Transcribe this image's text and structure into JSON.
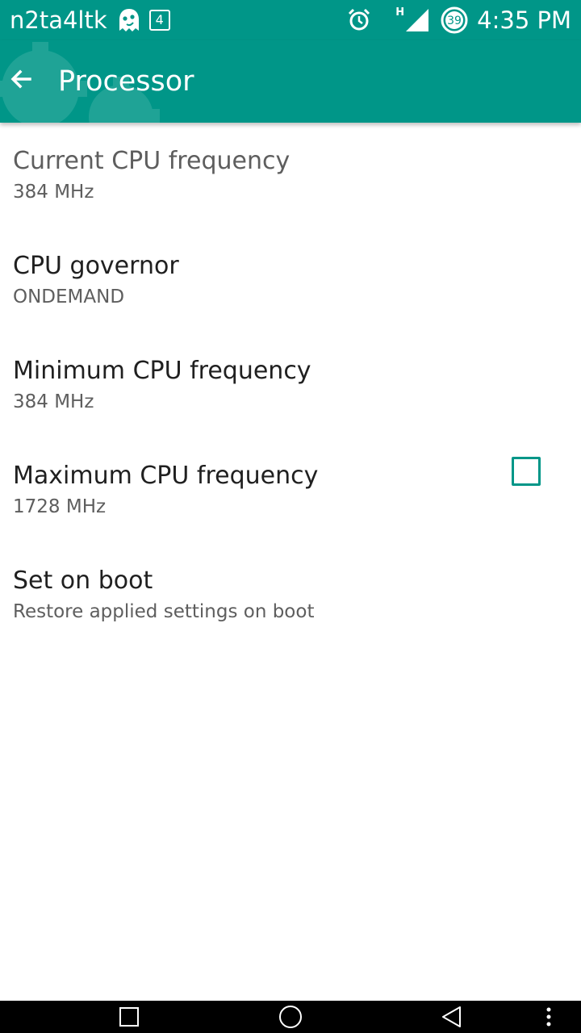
{
  "status_bar": {
    "carrier": "n2ta4ltk",
    "notification_count": "4",
    "battery_level": "39",
    "network_type": "H",
    "time": "4:35 PM",
    "icons": [
      "ghost-icon",
      "alarm-icon",
      "signal-icon",
      "battery-icon"
    ]
  },
  "app_bar": {
    "title": "Processor",
    "back_icon": "arrow-back-icon"
  },
  "preferences": [
    {
      "title": "Current CPU frequency",
      "summary": "384 MHz"
    },
    {
      "title": "CPU governor",
      "summary": "ONDEMAND"
    },
    {
      "title": "Minimum CPU frequency",
      "summary": "384 MHz"
    },
    {
      "title": "Maximum CPU frequency",
      "summary": "1728 MHz"
    },
    {
      "title": "Set on boot",
      "summary": "Restore applied settings on boot",
      "checked": false
    }
  ],
  "nav_bar": {
    "icons": [
      "recents-icon",
      "home-icon",
      "back-icon",
      "more-icon"
    ]
  },
  "colors": {
    "accent": "#009688",
    "text_primary": "#202020",
    "text_secondary": "#5e5e5e"
  }
}
